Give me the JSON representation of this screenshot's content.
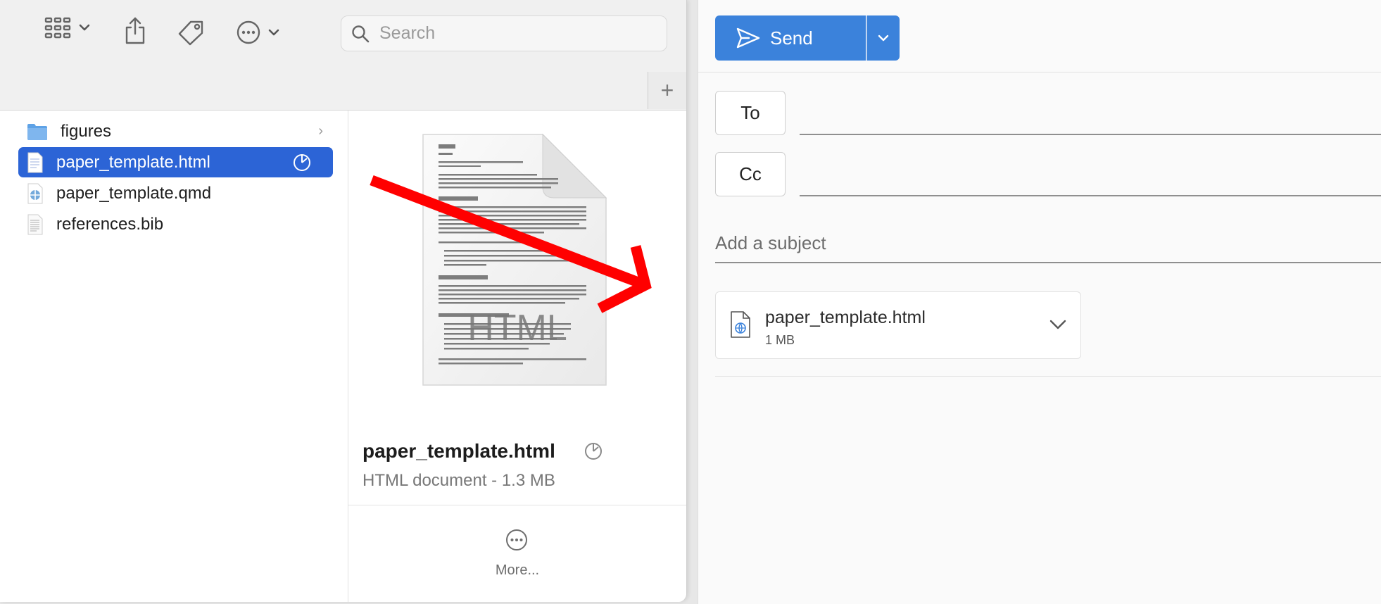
{
  "finder": {
    "search": {
      "placeholder": "Search"
    },
    "files": [
      {
        "name": "figures",
        "icon": "folder-icon"
      },
      {
        "name": "paper_template.html",
        "icon": "html-file-icon",
        "selected": true
      },
      {
        "name": "paper_template.qmd",
        "icon": "qmd-file-icon"
      },
      {
        "name": "references.bib",
        "icon": "bib-file-icon"
      }
    ],
    "preview": {
      "file_name": "paper_template.html",
      "kind": "HTML document - 1.3 MB",
      "thumb_label": "HTML",
      "more_label": "More..."
    }
  },
  "mail": {
    "send_label": "Send",
    "to_label": "To",
    "cc_label": "Cc",
    "subject_placeholder": "Add a subject",
    "attachment": {
      "name": "paper_template.html",
      "size": "1 MB"
    }
  },
  "colors": {
    "selection": "#2c64d6",
    "send_button": "#3b82db",
    "annotation_arrow": "#ff0000"
  }
}
